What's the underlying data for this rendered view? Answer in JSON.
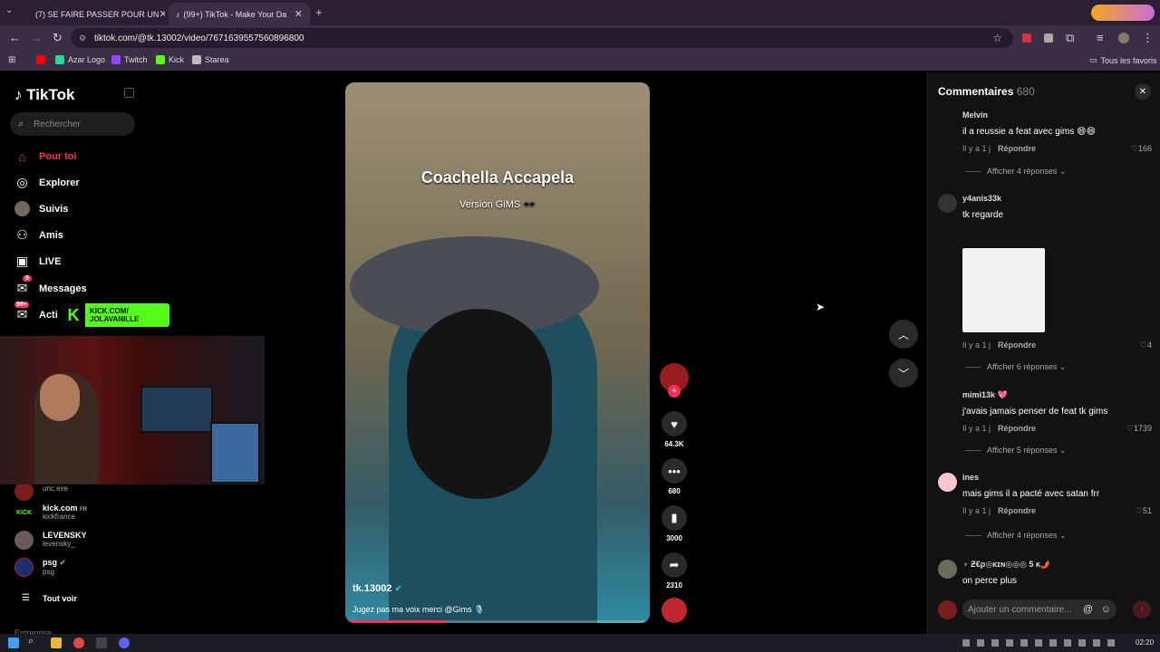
{
  "browser": {
    "tabs": [
      {
        "title": "(7) SE FAIRE PASSER POUR UN",
        "active": false
      },
      {
        "title": "(99+) TikTok - Make Your Da",
        "active": true
      }
    ],
    "url": "tiktok.com/@tk.13002/video/7671639557560896800",
    "bookmarks": [
      "Azar Logo",
      "Twitch",
      "Kick",
      "Starea"
    ],
    "all_favorites": "Tous les favoris"
  },
  "sidebar": {
    "logo": "TikTok",
    "search_placeholder": "Rechercher",
    "nav": [
      {
        "label": "Pour toi",
        "icon": "home-icon"
      },
      {
        "label": "Explorer",
        "icon": "compass-icon"
      },
      {
        "label": "Suivis",
        "icon": "following-avatar-icon"
      },
      {
        "label": "Amis",
        "icon": "friends-icon"
      },
      {
        "label": "LIVE",
        "icon": "live-icon"
      },
      {
        "label": "Messages",
        "icon": "messages-icon",
        "badge": "9"
      },
      {
        "label": "Acti",
        "icon": "activity-icon",
        "badge": "99+"
      }
    ],
    "accounts": [
      {
        "name": "",
        "handle": "unc.exe"
      },
      {
        "name": "kick.com",
        "tag": "FR",
        "handle": "kickfrance"
      },
      {
        "name": "LEVENSKY",
        "handle": "levensky_"
      },
      {
        "name": "psg",
        "handle": "psg",
        "verified": true
      }
    ],
    "see_all": "Tout voir",
    "footer": "Entreprise"
  },
  "kick_overlay": {
    "line1": "KICK.COM/",
    "line2": "JOLAVANILLE"
  },
  "video": {
    "title": "Coachella Accapela",
    "subtitle": "Version GiMS 🕶️",
    "author": "tk.13002",
    "caption": "Jugez pas ma voix merci @Gims 🎙️",
    "progress": 0.33
  },
  "actions": {
    "likes": "64.3K",
    "comments": "680",
    "saves": "3000",
    "shares": "2310"
  },
  "comments_panel": {
    "title": "Commentaires",
    "count": "680",
    "items": [
      {
        "user": "Melvin",
        "text": "il a reussie a feat avec gims 😄😄",
        "time": "Il y a 1 j",
        "reply": "Répondre",
        "likes": "166",
        "more": "Afficher 4 réponses"
      },
      {
        "user": "y4anis33k",
        "text": "tk regarde",
        "time": "Il y a 1 j",
        "reply": "Répondre",
        "likes": "4",
        "more": "Afficher 6 réponses"
      },
      {
        "user": "mimi13k 💖",
        "text": "j'avais jamais penser de feat tk gims",
        "time": "Il y a 1 j",
        "reply": "Répondre",
        "likes": "1739",
        "more": "Afficher 5 réponses"
      },
      {
        "user": "ines",
        "text": "mais gims il a pacté avec satan frr",
        "time": "Il y a 1 j",
        "reply": "Répondre",
        "likes": "51",
        "more": "Afficher 4 réponses"
      },
      {
        "user": "♆ Ƶ€ρ◎ĸɪɴ◎◎◎ 5 ĸ🌶️",
        "text": "on perce plus"
      }
    ],
    "input_placeholder": "Ajouter un commentaire..."
  },
  "taskbar": {
    "time": "02:20"
  },
  "colors": {
    "accent": "#fe2c55",
    "kick": "#53fc18"
  }
}
